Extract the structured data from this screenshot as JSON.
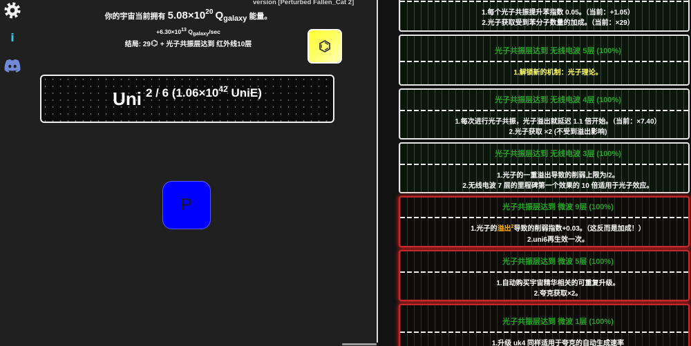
{
  "version": "version [Perturbed Fallen_Cat 2]",
  "sidebar": {
    "settings_icon": "gear-icon",
    "info_label": "i",
    "discord_icon": "discord-icon"
  },
  "energy": {
    "prefix": "你的宇宙当前拥有",
    "mantissa": "5.08×10",
    "exponent": "20",
    "unit": "Q",
    "unit_sub": "galaxy",
    "suffix": "能量。"
  },
  "rate": {
    "mantissa": "+6.30×10",
    "exponent": "13",
    "unit": "Q",
    "unit_sub": "galaxy",
    "suffix": "/sec"
  },
  "ending": {
    "label": "结局: 29",
    "icon": "benzene-icon",
    "text": "+ 光子共振层达到 红外线10层"
  },
  "benzene_button": {
    "icon": "benzene-icon"
  },
  "uni": {
    "label": "Uni",
    "tier": "2 / 6 (1.06×10",
    "exponent": "42",
    "unit": "UniE)"
  },
  "p_button": {
    "label": "P"
  },
  "milestones": {
    "partial": {
      "lines": [
        "1.每个光子共振提升苯指数 0.05。（当前：+1.05）",
        "2.光子获取受到苯分子数量的加成。（当前：×29）"
      ]
    },
    "items": [
      {
        "title": "光子共振层达到 无线电波 5层 (100%)",
        "lines": [
          "1.解锁新的机制：光子理论。"
        ]
      },
      {
        "title": "光子共振层达到 无线电波 4层 (100%)",
        "lines": [
          "1.每次进行光子共振，光子溢出就延迟 1.1 倍开始。（当前：×7.40）",
          "2.光子获取 ×2 (不受到溢出影响)"
        ]
      },
      {
        "title": "光子共振层达到 无线电波 3层 (100%)",
        "lines": [
          "1.光子的一重溢出导致的削弱上限为/2。",
          "2.无线电波 7 层的里程碑第一个效果的 10 倍适用于光子效应。"
        ]
      },
      {
        "title": "光子共振层达到 微波 9层 (100%)",
        "lines": [
          {
            "before": "1.光子的",
            "highlight": "溢出",
            "sup": "2",
            "after": "导致的削弱指数+0.03。（这反而是加成！）"
          },
          "2.uni6再生效一次。"
        ]
      },
      {
        "title": "光子共振层达到 微波 5层 (100%)",
        "lines": [
          "1.自动购买宇宙精华相关的可重复升级。",
          "2.夸克获取×2。"
        ]
      },
      {
        "title": "光子共振层达到 微波 1层 (100%)",
        "lines": [
          "1.升级 uk4 同样适用于夸克的自动生成速率"
        ]
      }
    ]
  },
  "colors": {
    "panel_bg": "#202020",
    "right_bg": "#121212",
    "milestone_title": "#25a425",
    "unlock_text": "#ffff70",
    "overflow_highlight": "#ffb000",
    "microwave_border": "#c42a2a",
    "radio_border": "#e6e6e6",
    "info_icon": "#33c4e6",
    "discord_icon": "#7289da",
    "p_button": "#0000ff",
    "benzene_button": "#ffff33"
  }
}
